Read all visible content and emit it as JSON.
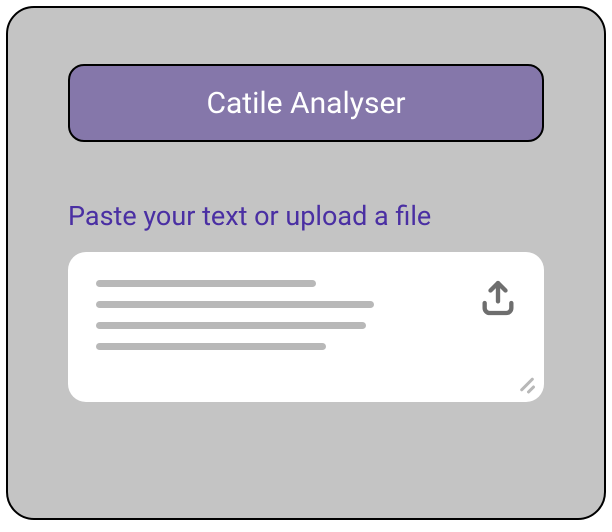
{
  "header": {
    "title": "Catile Analyser"
  },
  "input": {
    "prompt_label": "Paste your text or upload a file",
    "placeholder": ""
  },
  "icons": {
    "upload": "upload-icon"
  },
  "colors": {
    "accent": "#8577aa",
    "label": "#4a2fa3"
  }
}
